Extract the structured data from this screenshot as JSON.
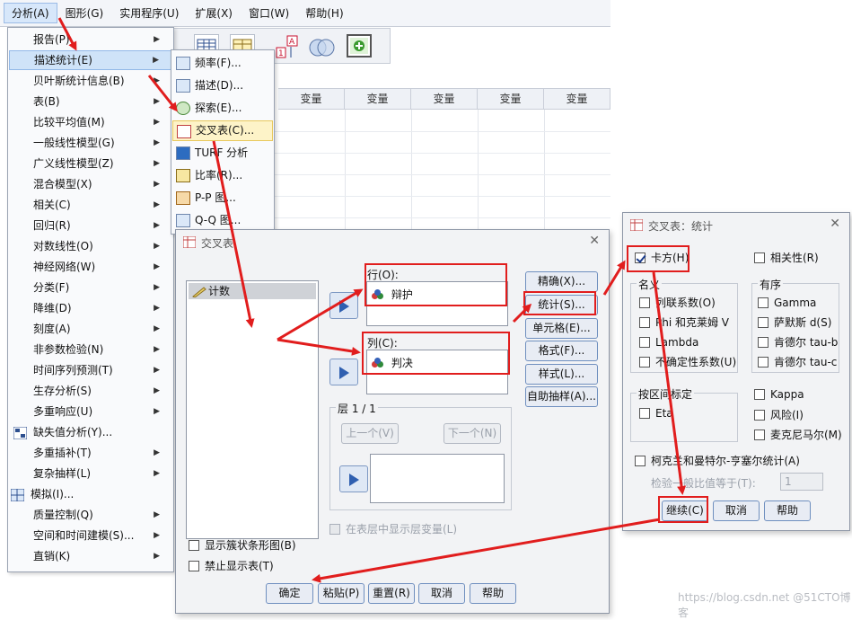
{
  "menubar": {
    "items": [
      "分析(A)",
      "图形(G)",
      "实用程序(U)",
      "扩展(X)",
      "窗口(W)",
      "帮助(H)"
    ]
  },
  "grid": {
    "columns": [
      "变量",
      "变量",
      "变量",
      "变量",
      "变量"
    ]
  },
  "analyze_menu": {
    "items": [
      "报告(P)",
      "描述统计(E)",
      "贝叶斯统计信息(B)",
      "表(B)",
      "比较平均值(M)",
      "一般线性模型(G)",
      "广义线性模型(Z)",
      "混合模型(X)",
      "相关(C)",
      "回归(R)",
      "对数线性(O)",
      "神经网络(W)",
      "分类(F)",
      "降维(D)",
      "刻度(A)",
      "非参数检验(N)",
      "时间序列预测(T)",
      "生存分析(S)",
      "多重响应(U)",
      "缺失值分析(Y)...",
      "多重插补(T)",
      "复杂抽样(L)",
      "模拟(I)...",
      "质量控制(Q)",
      "空间和时间建模(S)...",
      "直销(K)"
    ]
  },
  "descriptive_submenu": {
    "items": [
      "频率(F)...",
      "描述(D)...",
      "探索(E)...",
      "交叉表(C)...",
      "TURF 分析",
      "比率(R)...",
      "P-P 图...",
      "Q-Q 图..."
    ]
  },
  "crosstabs": {
    "title": "交叉表",
    "source_var": "计数",
    "row_label": "行(O):",
    "row_var": "辩护",
    "col_label": "列(C):",
    "col_var": "判决",
    "layer_label": "层 1 / 1",
    "prev_btn": "上一个(V)",
    "next_btn": "下一个(N)",
    "layer_show_cb": "在表层中显示层变量(L)",
    "side_buttons": [
      "精确(X)...",
      "统计(S)...",
      "单元格(E)...",
      "格式(F)...",
      "样式(L)...",
      "自助抽样(A)..."
    ],
    "show_bar_chart": "显示簇状条形图(B)",
    "suppress_tables": "禁止显示表(T)",
    "bottom_buttons": [
      "确定",
      "粘贴(P)",
      "重置(R)",
      "取消",
      "帮助"
    ]
  },
  "stats_dialog": {
    "title": "交叉表：统计",
    "chi_square": "卡方(H)",
    "correlations": "相关性(R)",
    "nominal_label": "名义",
    "nominal_items": [
      "列联系数(O)",
      "Phi 和克莱姆 V",
      "Lambda",
      "不确定性系数(U)"
    ],
    "ordinal_label": "有序",
    "ordinal_items": [
      "Gamma",
      "萨默斯 d(S)",
      "肯德尔 tau-b",
      "肯德尔 tau-c"
    ],
    "interval_label": "按区间标定",
    "eta": "Eta",
    "kappa": "Kappa",
    "risk": "风险(I)",
    "mcnemar": "麦克尼马尔(M)",
    "cmh": "柯克兰和曼特尔-亨塞尔统计(A)",
    "test_ratio_label": "检验一般比值等于(T):",
    "test_ratio_value": "1",
    "buttons": [
      "继续(C)",
      "取消",
      "帮助"
    ]
  },
  "watermark": "https://blog.csdn.net  @51CTO博客",
  "colors": {
    "annotation_red": "#e11d1d",
    "highlight_blue": "#cfe3f8",
    "highlight_yellow": "#fdf3c8"
  }
}
